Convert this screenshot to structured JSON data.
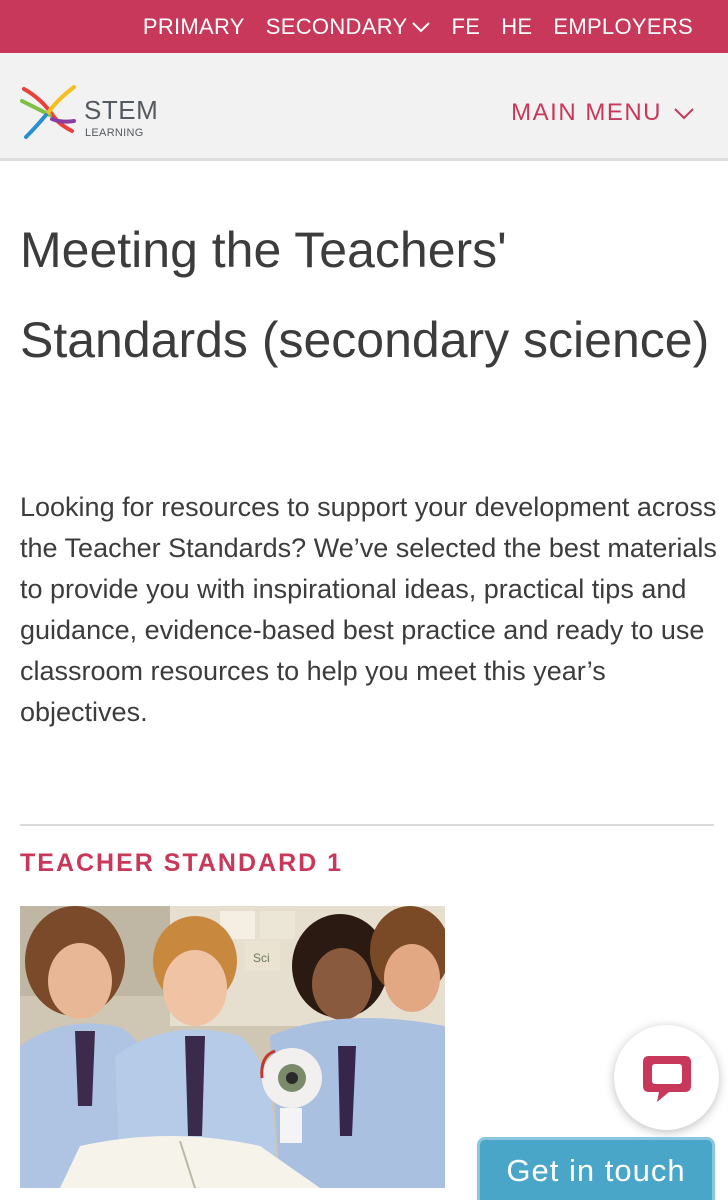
{
  "topnav": {
    "items": [
      {
        "label": "PRIMARY"
      },
      {
        "label": "SECONDARY"
      },
      {
        "label": "FE"
      },
      {
        "label": "HE"
      },
      {
        "label": "EMPLOYERS"
      }
    ]
  },
  "header": {
    "logo_stem": "STEM",
    "logo_learning": "LEARNING",
    "main_menu_label": "MAIN MENU"
  },
  "main": {
    "title": "Meeting the Teachers' Standards (secondary science)",
    "intro": "Looking for resources to support your development across the Teacher Standards? We’ve selected the best materials to provide you with inspirational ideas, practical tips and guidance, evidence-based best practice and ready to use classroom resources to help you meet this year’s objectives.",
    "standard_heading": "TEACHER STANDARD 1",
    "photo_sign": "Sci"
  },
  "widgets": {
    "get_in_touch_label": "Get in touch"
  },
  "colors": {
    "brand": "#c8385a",
    "accent": "#4aa6c8"
  },
  "icons": {
    "secondary_dropdown": "chevron-down-icon",
    "main_menu": "chevron-down-icon",
    "chat": "chat-icon"
  }
}
